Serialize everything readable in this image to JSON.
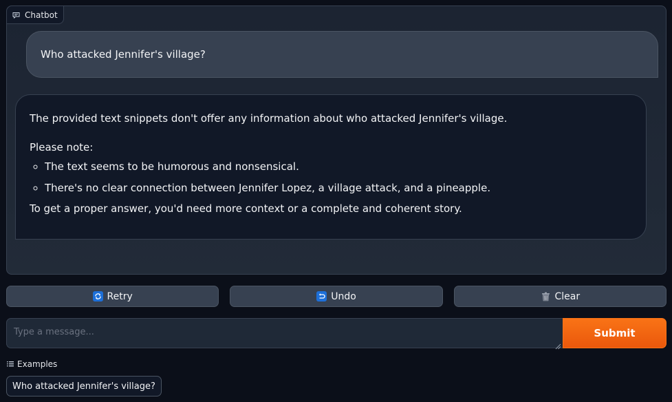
{
  "chatbot": {
    "label": "Chatbot",
    "label_icon": "chat-icon",
    "messages": [
      {
        "role": "user",
        "text": "Who attacked Jennifer's village?"
      },
      {
        "role": "bot",
        "intro": "The provided text snippets don't offer any information about who attacked Jennifer's village.",
        "note_heading": "Please note:",
        "bullets": [
          "The text seems to be humorous and nonsensical.",
          "There's no clear connection between Jennifer Lopez, a village attack, and a pineapple."
        ],
        "closing": "To get a proper answer, you'd need more context or a complete and coherent story."
      }
    ]
  },
  "buttons": {
    "retry": {
      "label": "Retry",
      "icon": "retry-icon",
      "emoji": "🔄"
    },
    "undo": {
      "label": "Undo",
      "icon": "undo-icon",
      "emoji": "↩"
    },
    "clear": {
      "label": "Clear",
      "icon": "trash-icon",
      "emoji": "🗑️"
    }
  },
  "input": {
    "placeholder": "Type a message...",
    "value": ""
  },
  "submit": {
    "label": "Submit",
    "color": "#f97316"
  },
  "examples": {
    "label": "Examples",
    "label_icon": "list-icon",
    "items": [
      "Who attacked Jennifer's village?"
    ]
  }
}
